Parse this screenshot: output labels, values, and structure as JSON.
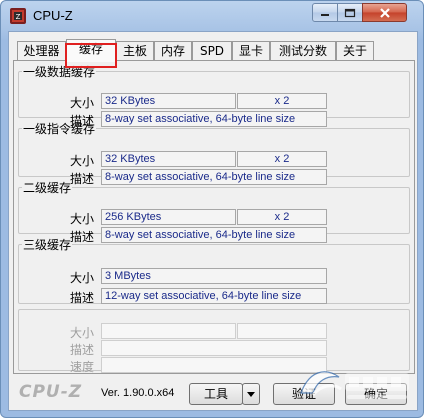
{
  "window": {
    "title": "CPU-Z",
    "icon": "cpu-z-app-icon",
    "controls": [
      "minimize-icon",
      "maximize-icon",
      "close-icon"
    ]
  },
  "tabs": [
    {
      "label": "处理器",
      "active": false
    },
    {
      "label": "缓存",
      "active": true
    },
    {
      "label": "主板",
      "active": false
    },
    {
      "label": "内存",
      "active": false
    },
    {
      "label": "SPD",
      "active": false
    },
    {
      "label": "显卡",
      "active": false
    },
    {
      "label": "测试分数",
      "active": false
    },
    {
      "label": "关于",
      "active": false
    }
  ],
  "groups": {
    "l1d": {
      "title": "一级数据缓存",
      "size_label": "大小",
      "size": "32 KBytes",
      "count": "x 2",
      "desc_label": "描述",
      "desc": "8-way set associative, 64-byte line size"
    },
    "l1i": {
      "title": "一级指令缓存",
      "size_label": "大小",
      "size": "32 KBytes",
      "count": "x 2",
      "desc_label": "描述",
      "desc": "8-way set associative, 64-byte line size"
    },
    "l2": {
      "title": "二级缓存",
      "size_label": "大小",
      "size": "256 KBytes",
      "count": "x 2",
      "desc_label": "描述",
      "desc": "8-way set associative, 64-byte line size"
    },
    "l3": {
      "title": "三级缓存",
      "size_label": "大小",
      "size": "3 MBytes",
      "count": "",
      "desc_label": "描述",
      "desc": "12-way set associative, 64-byte line size"
    },
    "empty": {
      "size_label": "大小",
      "desc_label": "描述",
      "speed_label": "速度"
    }
  },
  "footer": {
    "brand": "CPU-Z",
    "version": "Ver. 1.90.0.x64",
    "tools_label": "工具",
    "verify_label": "验证",
    "ok_label": "确定"
  },
  "colors": {
    "value_text": "#1a2a8a",
    "active_tab_outline": "#e02020",
    "title_bar": "#a9c4e6"
  }
}
